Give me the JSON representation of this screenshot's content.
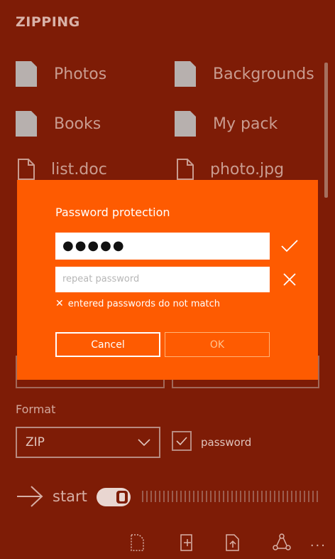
{
  "header": {
    "title": "ZIPPING"
  },
  "items": [
    {
      "label": "Photos",
      "type": "folder"
    },
    {
      "label": "Backgrounds",
      "type": "folder"
    },
    {
      "label": "Books",
      "type": "folder"
    },
    {
      "label": "My pack",
      "type": "folder"
    },
    {
      "label": "list.doc",
      "type": "file"
    },
    {
      "label": "photo.jpg",
      "type": "file"
    }
  ],
  "format": {
    "label": "Format",
    "selected": "ZIP",
    "password_checkbox_label": "password",
    "password_checked": true
  },
  "start": {
    "label": "start"
  },
  "dialog": {
    "title": "Password protection",
    "password_value": "●●●●●",
    "repeat_placeholder": "repeat password",
    "error": "entered passwords do not match",
    "cancel_label": "Cancel",
    "ok_label": "OK"
  },
  "colors": {
    "background": "#7e1c06",
    "accent": "#fe5b01"
  },
  "appbar": {
    "more": "..."
  }
}
